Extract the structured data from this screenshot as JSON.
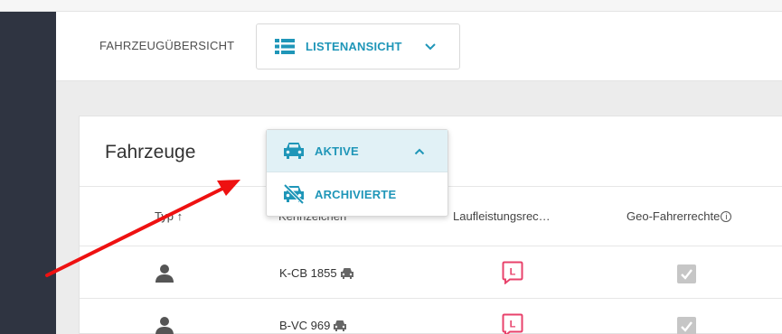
{
  "header": {
    "overview_label": "FAHRZEUGÜBERSICHT",
    "view_select": {
      "label": "LISTENANSICHT"
    }
  },
  "card": {
    "title": "Fahrzeuge",
    "columns": {
      "type": "Typ",
      "type_sort": "↑",
      "plate": "Kennzeichen",
      "mileage": "Laufleistungsrec…",
      "geo": "Geo-Fahrerrechte",
      "geo_info": "i"
    },
    "rows": [
      {
        "plate": "K-CB 1855",
        "type_icon": "person-icon",
        "vehicle_icon": "car-icon",
        "mileage_badge": "L",
        "geo_checked": true
      },
      {
        "plate": "B-VC 969",
        "type_icon": "person-icon",
        "vehicle_icon": "car-icon",
        "mileage_badge": "L",
        "geo_checked": true
      }
    ]
  },
  "status_dropdown": {
    "options": [
      {
        "label": "AKTIVE",
        "icon": "car-icon",
        "selected": true
      },
      {
        "label": "ARCHIVIERTE",
        "icon": "car-off-icon",
        "selected": false
      }
    ]
  },
  "colors": {
    "accent": "#1f96b8",
    "sidebar": "#2f3441",
    "badge": "#e8426b",
    "checkbox": "#c6c6c6",
    "annotation_arrow": "#ee1111"
  }
}
